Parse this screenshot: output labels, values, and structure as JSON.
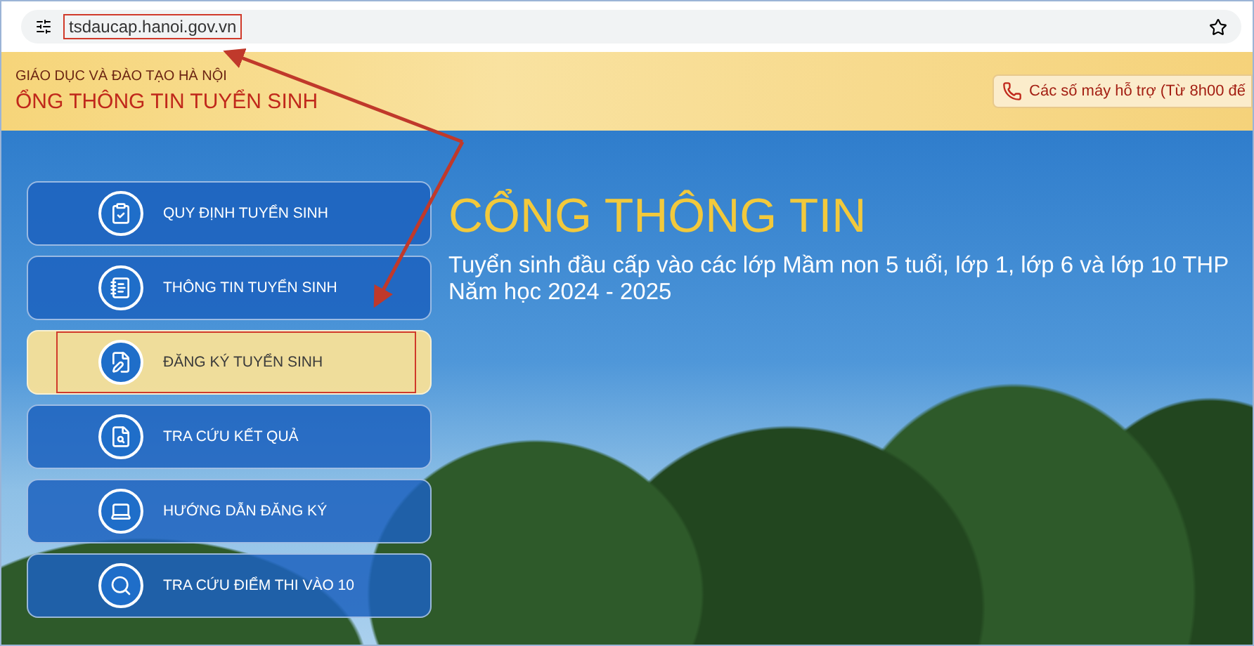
{
  "browser": {
    "url": "tsdaucap.hanoi.gov.vn",
    "url_highlighted": true
  },
  "header": {
    "org": "GIÁO DỤC VÀ ĐÀO TẠO HÀ NỘI",
    "site": "ỔNG THÔNG TIN TUYỂN SINH",
    "hotline": "Các số máy hỗ trợ (Từ 8h00 đế"
  },
  "menu": [
    {
      "label": "QUY ĐỊNH TUYỂN SINH",
      "selected": false,
      "highlighted": false
    },
    {
      "label": "THÔNG TIN TUYỂN SINH",
      "selected": false,
      "highlighted": false
    },
    {
      "label": "ĐĂNG KÝ TUYỂN SINH",
      "selected": true,
      "highlighted": true
    },
    {
      "label": "TRA CỨU KẾT QUẢ",
      "selected": false,
      "highlighted": false
    },
    {
      "label": "HƯỚNG DẪN ĐĂNG KÝ",
      "selected": false,
      "highlighted": false
    },
    {
      "label": "TRA CỨU ĐIỂM THI VÀO 10",
      "selected": false,
      "highlighted": false
    }
  ],
  "hero": {
    "title": "CỔNG THÔNG TIN",
    "subtitle": "Tuyển sinh đầu cấp vào các lớp Mầm non 5 tuổi, lớp 1, lớp 6 và lớp 10 THP",
    "year": "Năm học 2024 - 2025"
  },
  "annotation_arrows": true
}
